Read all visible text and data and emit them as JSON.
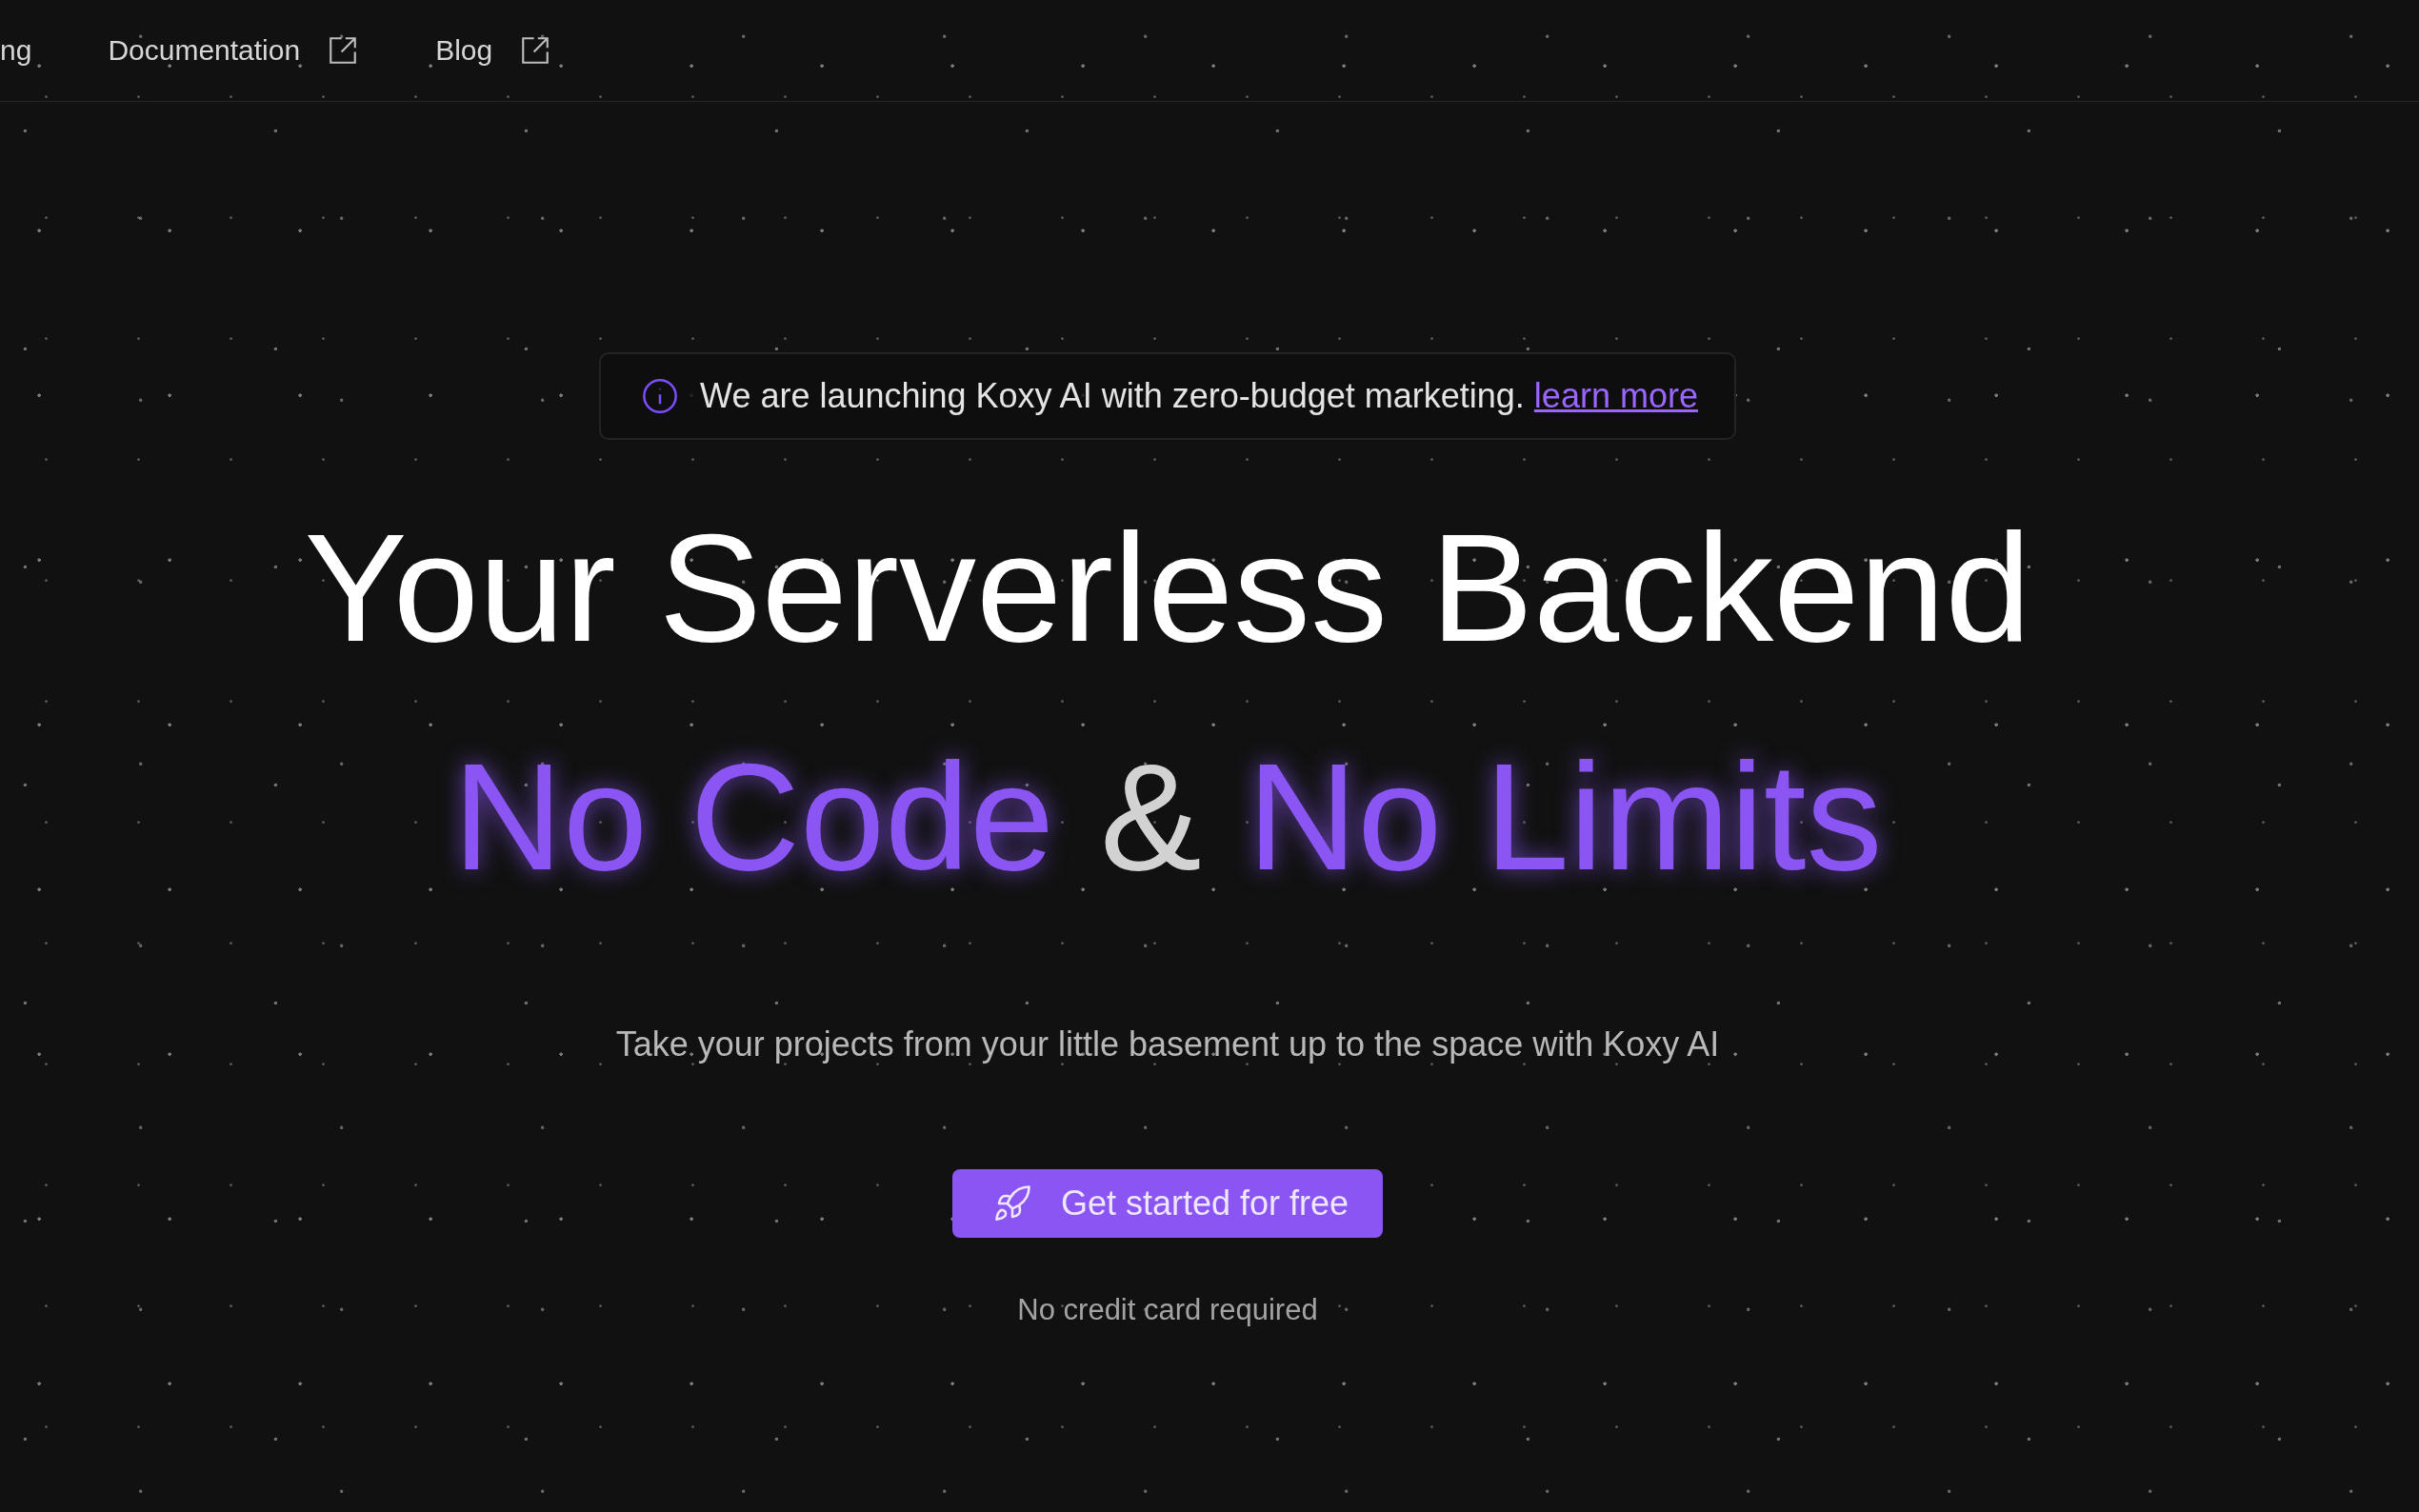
{
  "nav": {
    "items": [
      {
        "label": "ng",
        "external": false
      },
      {
        "label": "Documentation",
        "external": true
      },
      {
        "label": "Blog",
        "external": true
      }
    ]
  },
  "announcement": {
    "text": "We are launching Koxy AI with zero-budget marketing.",
    "link": "learn more"
  },
  "headline": "Your Serverless Backend",
  "tagline": [
    {
      "text": "No Code",
      "kind": "accent"
    },
    {
      "text": "&",
      "kind": "plain"
    },
    {
      "text": "No Limits",
      "kind": "accent"
    }
  ],
  "subtitle": "Take your projects from your little basement up to the space with Koxy AI",
  "cta": {
    "label": "Get started for free"
  },
  "note": "No credit card required"
}
